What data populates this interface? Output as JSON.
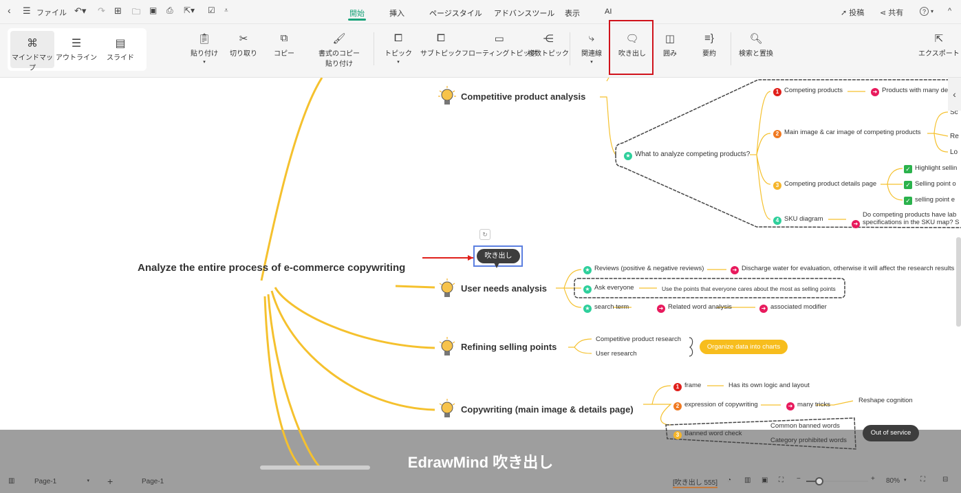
{
  "topbar": {
    "back": "‹",
    "menu": "☰",
    "file": "ファイル",
    "tabs": [
      "開始",
      "挿入",
      "ページスタイル",
      "アドバンスツール",
      "表示",
      "AI"
    ],
    "active_tab": "開始",
    "publish": "投稿",
    "share": "共有",
    "help": "?"
  },
  "ribbon": {
    "views": [
      {
        "label": "マインドマップ",
        "icon": "mindmap-icon"
      },
      {
        "label": "アウトライン",
        "icon": "outline-icon"
      },
      {
        "label": "スライド",
        "icon": "slide-icon"
      }
    ],
    "paste": "貼り付け",
    "cut": "切り取り",
    "copy": "コピー",
    "format_painter": [
      "書式のコピー",
      "貼り付け"
    ],
    "topic": "トピック",
    "subtopic": "サブトピック",
    "floating": "フローティングトピック",
    "multiple": "複数トピック",
    "relation": "関連線",
    "callout": "吹き出し",
    "boundary": "囲み",
    "summary": "要約",
    "find_replace": "検索と置換",
    "export": "エクスポート"
  },
  "mindmap": {
    "root": "Analyze the entire process of e-commerce copywriting",
    "main": [
      "Competitive product analysis",
      "User needs analysis",
      "Refining selling points",
      "Copywriting (main image & details page)"
    ],
    "callout": "吹き出し",
    "competitive": {
      "question": "What to analyze competing products?",
      "items": [
        "Competing products",
        "Main image & car image of competing products",
        "Competing product details page",
        "SKU diagram"
      ],
      "products_leaf": "Products with many de",
      "main_image_leaves": [
        "Sc",
        "Re",
        "Lo"
      ],
      "details_leaves": [
        "Highlight sellin",
        "Selling point o",
        "selling point e"
      ],
      "sku_leaf": [
        "Do competing products have lab",
        "specifications in the SKU map? S"
      ]
    },
    "user": {
      "items": [
        "Reviews (positive & negative reviews)",
        "Ask everyone",
        "search term"
      ],
      "reviews_leaf": "Discharge water for evaluation, otherwise it will affect the research results",
      "ask_leaf": "Use the points that everyone cares about the most as selling points",
      "search_leaves": [
        "Related word analysis",
        "associated modifier"
      ]
    },
    "refining": {
      "items": [
        "Competitive product research",
        "User research"
      ],
      "summary": "Organize data into charts"
    },
    "copy": {
      "items": [
        "frame",
        "expression of copywriting",
        "Banned word check"
      ],
      "frame_leaf": "Has its own logic and layout",
      "expr_leaf": "many tricks",
      "expr_leaf2": "Reshape cognition",
      "banned_leaves": [
        "Common banned words",
        "Category prohibited words"
      ],
      "banned_callout": "Out of service"
    }
  },
  "status": {
    "page_select": "Page-1",
    "page_tab": "Page-1",
    "selection": "[吹き出し 555]",
    "zoom": "80%"
  },
  "caption": "EdrawMind 吹き出し",
  "colors": {
    "accent": "#1aa37a",
    "branch": "#f5c12e",
    "highlight": "#d0121b",
    "red": "#e0201b",
    "orange": "#f07a22",
    "yellow": "#f5b52a",
    "teal": "#2ecf9b",
    "pink": "#e81a5d"
  }
}
